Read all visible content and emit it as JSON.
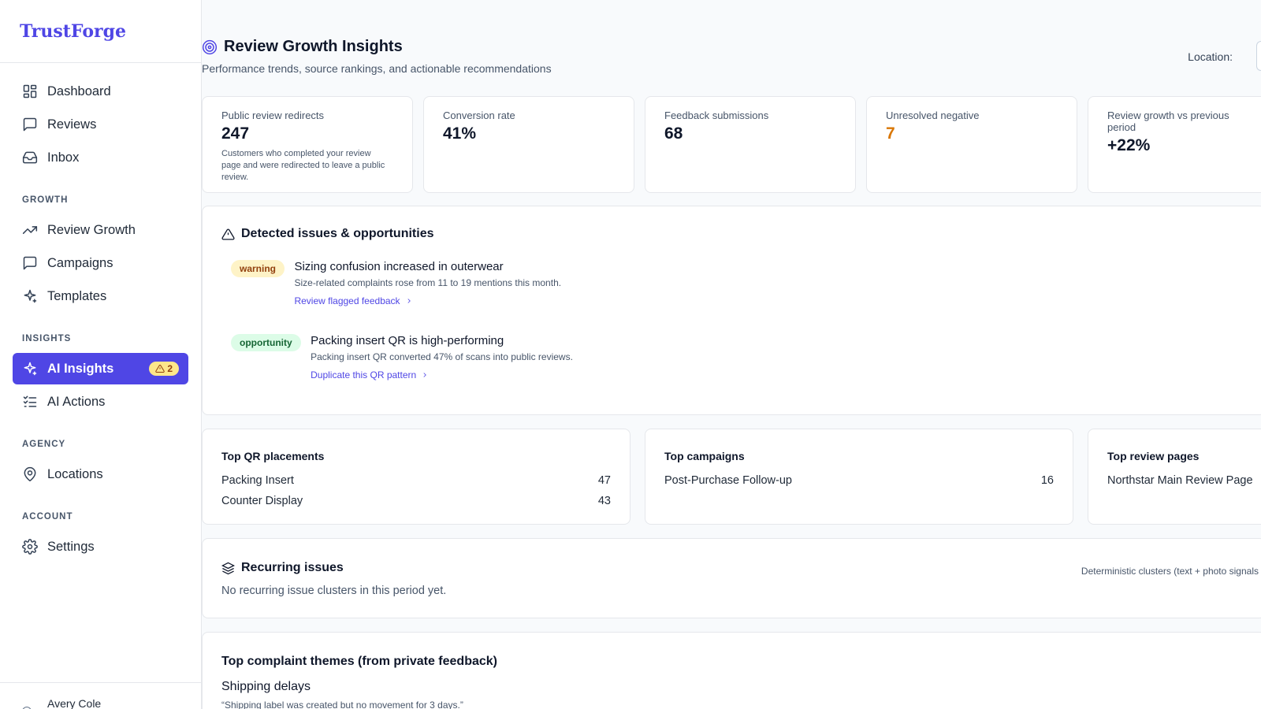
{
  "brand": "TrustForge",
  "sidebar": {
    "main": [
      {
        "label": "Dashboard",
        "icon": "dashboard-icon"
      },
      {
        "label": "Reviews",
        "icon": "message-icon"
      },
      {
        "label": "Inbox",
        "icon": "inbox-icon"
      }
    ],
    "growth_label": "GROWTH",
    "growth": [
      {
        "label": "Review Growth",
        "icon": "trending-up-icon"
      },
      {
        "label": "Campaigns",
        "icon": "message-icon"
      },
      {
        "label": "Templates",
        "icon": "sparkles-icon"
      }
    ],
    "insights_label": "INSIGHTS",
    "insights": [
      {
        "label": "AI Insights",
        "icon": "sparkles-icon",
        "badge": "2",
        "active": true
      },
      {
        "label": "AI Actions",
        "icon": "checklist-icon"
      }
    ],
    "agency_label": "AGENCY",
    "agency": [
      {
        "label": "Locations",
        "icon": "map-pin-icon"
      }
    ],
    "account_label": "ACCOUNT",
    "account": [
      {
        "label": "Settings",
        "icon": "gear-icon"
      }
    ],
    "user_name": "Avery Cole"
  },
  "header": {
    "title": "Review Growth Insights",
    "subtitle": "Performance trends, source rankings, and actionable recommendations",
    "location_label": "Location:"
  },
  "stats": [
    {
      "label": "Public review redirects",
      "value": "247",
      "desc": "Customers who completed your review page and were redirected to leave a public review."
    },
    {
      "label": "Conversion rate",
      "value": "41%",
      "desc": ""
    },
    {
      "label": "Feedback submissions",
      "value": "68",
      "desc": ""
    },
    {
      "label": "Unresolved negative",
      "value": "7",
      "desc": "",
      "accent": "#d97706"
    },
    {
      "label": "Review growth vs previous period",
      "value": "+22%",
      "desc": ""
    }
  ],
  "issues": {
    "title": "Detected issues & opportunities",
    "items": [
      {
        "tag": "warning",
        "title": "Sizing confusion increased in outerwear",
        "desc": "Size-related complaints rose from 11 to 19 mentions this month.",
        "link": "Review flagged feedback"
      },
      {
        "tag": "opportunity",
        "title": "Packing insert QR is high-performing",
        "desc": "Packing insert QR converted 47% of scans into public reviews.",
        "link": "Duplicate this QR pattern"
      }
    ]
  },
  "rankings": [
    {
      "title": "Top QR placements",
      "rows": [
        {
          "name": "Packing Insert",
          "value": "47"
        },
        {
          "name": "Counter Display",
          "value": "43"
        }
      ]
    },
    {
      "title": "Top campaigns",
      "rows": [
        {
          "name": "Post-Purchase Follow-up",
          "value": "16"
        }
      ]
    },
    {
      "title": "Top review pages",
      "rows": [
        {
          "name": "Northstar Main Review Page",
          "value": ""
        }
      ]
    }
  ],
  "recurring": {
    "title": "Recurring issues",
    "hint": "Deterministic clusters (text + photo signals",
    "empty": "No recurring issue clusters in this period yet."
  },
  "complaints": {
    "title": "Top complaint themes (from private feedback)",
    "theme": "Shipping delays",
    "quote": "“Shipping label was created but no movement for 3 days.”"
  },
  "colors": {
    "accent": "#4f46e5",
    "warning_bg": "#fef3c7",
    "opportunity_bg": "#dcfce7",
    "orange": "#d97706"
  }
}
